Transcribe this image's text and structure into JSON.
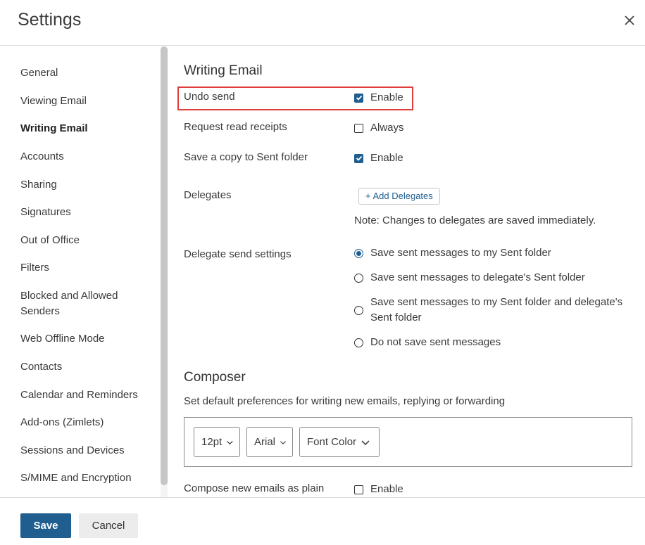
{
  "dialog": {
    "title": "Settings"
  },
  "sidebar": {
    "items": [
      {
        "label": "General",
        "active": false
      },
      {
        "label": "Viewing Email",
        "active": false
      },
      {
        "label": "Writing Email",
        "active": true
      },
      {
        "label": "Accounts",
        "active": false
      },
      {
        "label": "Sharing",
        "active": false
      },
      {
        "label": "Signatures",
        "active": false
      },
      {
        "label": "Out of Office",
        "active": false
      },
      {
        "label": "Filters",
        "active": false
      },
      {
        "label": "Blocked and Allowed Senders",
        "active": false
      },
      {
        "label": "Web Offline Mode",
        "active": false
      },
      {
        "label": "Contacts",
        "active": false
      },
      {
        "label": "Calendar and Reminders",
        "active": false
      },
      {
        "label": "Add-ons (Zimlets)",
        "active": false
      },
      {
        "label": "Sessions and Devices",
        "active": false
      },
      {
        "label": "S/MIME and Encryption",
        "active": false
      }
    ]
  },
  "writing_email": {
    "title": "Writing Email",
    "undo_send": {
      "label": "Undo send",
      "option": "Enable",
      "checked": true
    },
    "read_receipts": {
      "label": "Request read receipts",
      "option": "Always",
      "checked": false
    },
    "save_copy": {
      "label": "Save a copy to Sent folder",
      "option": "Enable",
      "checked": true
    },
    "delegates": {
      "label": "Delegates",
      "button": "+ Add Delegates",
      "note": "Note: Changes to delegates are saved immediately."
    },
    "delegate_send": {
      "label": "Delegate send settings",
      "options": [
        {
          "label": "Save sent messages to my Sent folder",
          "selected": true
        },
        {
          "label": "Save sent messages to delegate's Sent folder",
          "selected": false
        },
        {
          "label": "Save sent messages to my Sent folder and delegate's Sent folder",
          "selected": false
        },
        {
          "label": "Do not save sent messages",
          "selected": false
        }
      ]
    }
  },
  "composer": {
    "title": "Composer",
    "description": "Set default preferences for writing new emails, replying or forwarding",
    "font_size": "12pt",
    "font_family": "Arial",
    "font_color": "Font Color",
    "plain": {
      "label": "Compose new emails as plain",
      "option": "Enable",
      "checked": false
    }
  },
  "footer": {
    "save": "Save",
    "cancel": "Cancel"
  },
  "colors": {
    "accent": "#1f5e8f",
    "highlight": "#e03c3c"
  }
}
